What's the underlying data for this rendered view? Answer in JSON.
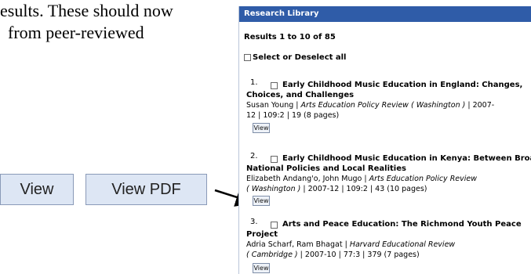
{
  "intro": {
    "line1": "esults. These should now",
    "line2": "from peer-reviewed"
  },
  "callout": {
    "view_label": "View",
    "view_pdf_label": "View PDF"
  },
  "panel": {
    "header": "Research Library",
    "results_count": "Results 1 to 10 of 85",
    "select_all_label": "Select or Deselect all",
    "view_label": "View",
    "items": [
      {
        "num": "1.",
        "title_line1": "Early Childhood Music Education in England: Changes,",
        "title_line2": "Choices, and Challenges",
        "authors": "Susan Young | ",
        "journal": "Arts Education Policy Review ( Washington )",
        "meta_tail": " | 2007-",
        "meta_line2": "12 | 109:2 | 19 (8 pages)"
      },
      {
        "num": "2.",
        "title_line1": "Early Childhood Music Education in Kenya: Between Broad",
        "title_line2": "National Policies and Local Realities",
        "authors": "Elizabeth Andang'o, John Mugo | ",
        "journal": "Arts Education Policy Review",
        "meta_line2_journal": "( Washington )",
        "meta_line2_tail": " | 2007-12 | 109:2 | 43 (10 pages)"
      },
      {
        "num": "3.",
        "title_line1": "Arts and Peace Education: The Richmond Youth Peace",
        "title_line2": "Project",
        "authors": "Adria Scharf, Ram Bhagat | ",
        "journal": "Harvard Educational Review",
        "meta_line2_journal": "( Cambridge )",
        "meta_line2_tail": " | 2007-10 | 77:3 | 379 (7 pages)"
      }
    ]
  }
}
